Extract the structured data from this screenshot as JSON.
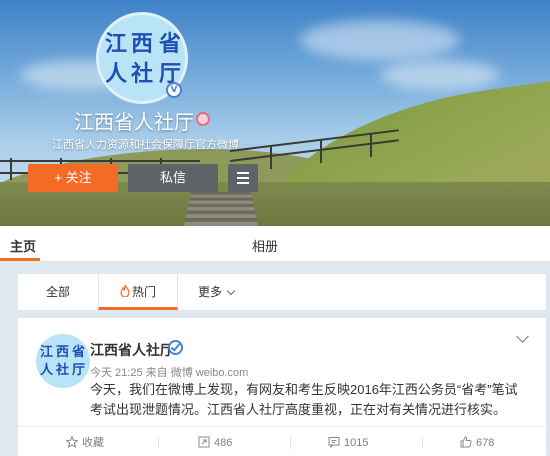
{
  "profile": {
    "avatar_chars": [
      "江",
      "西",
      "省",
      "人",
      "社",
      "厅"
    ],
    "verified_badge": "V",
    "name": "江西省人社厅",
    "description": "江西省人力资源和社会保障厅官方微博",
    "follow_label": "+ 关注",
    "message_label": "私信"
  },
  "tabs": {
    "main": "主页",
    "album": "相册"
  },
  "filter": {
    "all": "全部",
    "hot": "热门",
    "more": "更多"
  },
  "post": {
    "avatar_chars": [
      "江",
      "西",
      "省",
      "人",
      "社",
      "厅"
    ],
    "author": "江西省人社厅",
    "meta": "今天 21:25 来自 微博 weibo.com",
    "text": "今天，我们在微博上发现，有网友和考生反映2016年江西公务员“省考”笔试考试出现泄题情况。江西省人社厅高度重视，正在对有关情况进行核实。",
    "actions": {
      "favorite": "收藏",
      "repost": "486",
      "comment": "1015",
      "like": "678"
    }
  },
  "colors": {
    "accent": "#f36b26",
    "dark_button": "#5f6367",
    "verified": "#4a7fd4",
    "avatar_bg": "#b9e3f6",
    "avatar_text": "#1f4fb3"
  }
}
